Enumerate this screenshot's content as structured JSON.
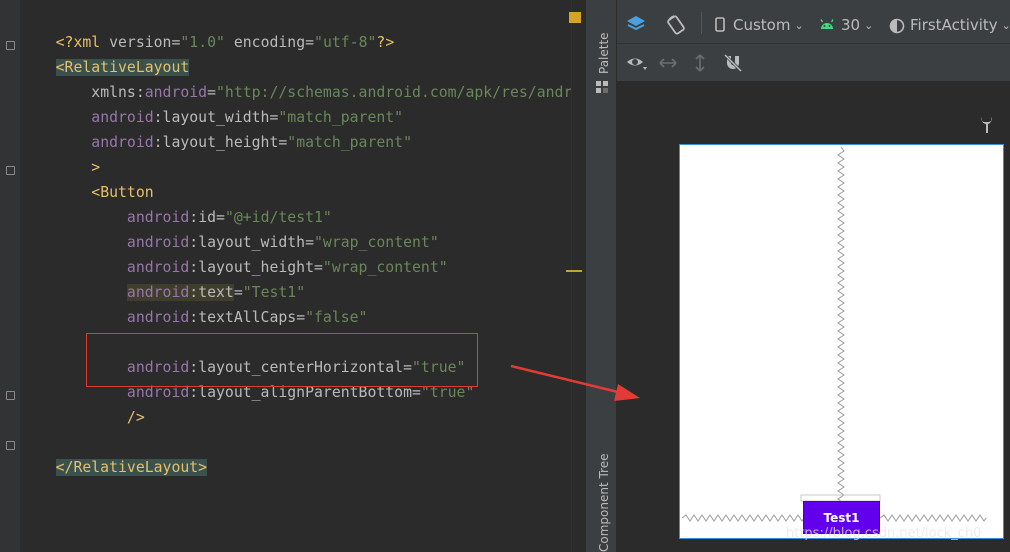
{
  "editor": {
    "lines": {
      "l1": {
        "open": "<?",
        "name": "xml ",
        "a1": "version",
        "eq1": "=",
        "v1": "\"1.0\"",
        "a2": " encoding",
        "eq2": "=",
        "v2": "\"utf-8\"",
        "close": "?>"
      },
      "l2": {
        "text": "<RelativeLayout"
      },
      "l3": {
        "indent": "    ",
        "a": "xmlns:",
        "ns": "android",
        "eq": "=",
        "v": "\"http://schemas.android.com/apk/res/android\""
      },
      "l4": {
        "indent": "    ",
        "ns": "android",
        "a": ":layout_width",
        "eq": "=",
        "v": "\"match_parent\""
      },
      "l5": {
        "indent": "    ",
        "ns": "android",
        "a": ":layout_height",
        "eq": "=",
        "v": "\"match_parent\""
      },
      "l6": {
        "indent": "    ",
        "text": ">"
      },
      "l7": {
        "indent": "    ",
        "text": "<Button"
      },
      "l8": {
        "indent": "        ",
        "ns": "android",
        "a": ":id",
        "eq": "=",
        "v": "\"@+id/test1\""
      },
      "l9": {
        "indent": "        ",
        "ns": "android",
        "a": ":layout_width",
        "eq": "=",
        "v": "\"wrap_content\""
      },
      "l10": {
        "indent": "        ",
        "ns": "android",
        "a": ":layout_height",
        "eq": "=",
        "v": "\"wrap_content\""
      },
      "l11": {
        "indent": "        ",
        "ns": "android",
        "a": ":text",
        "eq": "=",
        "v": "\"Test1\""
      },
      "l12": {
        "indent": "        ",
        "ns": "android",
        "a": ":textAllCaps",
        "eq": "=",
        "v": "\"false\""
      },
      "l14": {
        "indent": "        ",
        "ns": "android",
        "a": ":layout_centerHorizontal",
        "eq": "=",
        "v": "\"true\""
      },
      "l15": {
        "indent": "        ",
        "ns": "android",
        "a": ":layout_alignParentBottom",
        "eq": "=",
        "v": "\"true\""
      },
      "l16": {
        "indent": "        ",
        "text": "/>"
      },
      "l18": {
        "text": "</RelativeLayout>"
      }
    }
  },
  "side_strip": {
    "palette_label": "Palette",
    "component_tree_label": "Component Tree"
  },
  "design_toolbar": {
    "device_label": "Custom",
    "api_label": "30",
    "activity_label": "FirstActivity"
  },
  "preview": {
    "button_label": "Test1"
  },
  "watermark": "https://blog.csdn.net/lock_ch0",
  "colors": {
    "tag": "#e8bf6a",
    "namespace": "#9876aa",
    "value": "#6a8759",
    "button_bg": "#6200ee",
    "highlight_box": "#e03c35"
  }
}
